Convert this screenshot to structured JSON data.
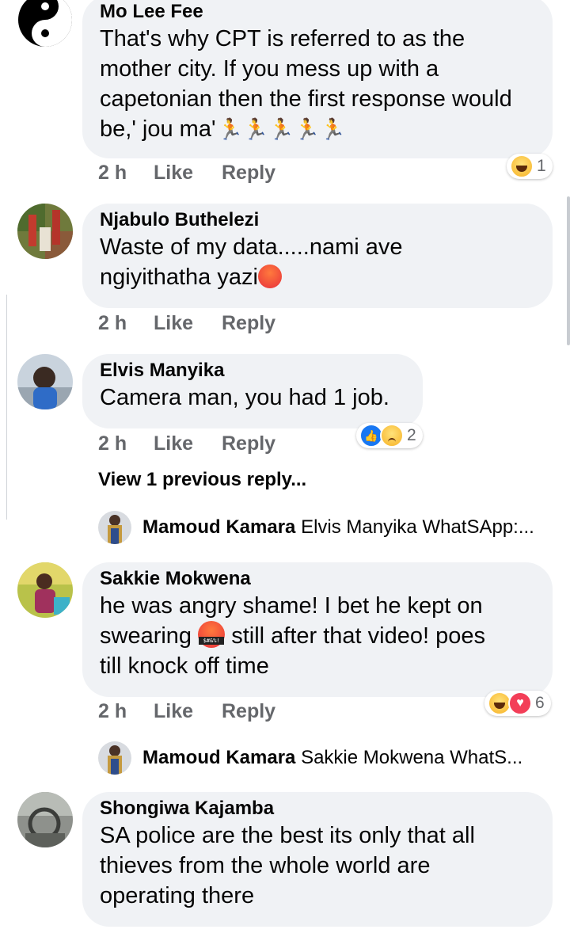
{
  "comments": [
    {
      "author": "Mo Lee Fee",
      "text": "That's why CPT is referred to as the mother city. If you mess up with a capetonian then the first response would be,' jou ma'",
      "emoji_tail": "🏃🏃🏃🏃🏃",
      "time": "2 h",
      "like": "Like",
      "reply": "Reply",
      "reactions": [
        "haha"
      ],
      "reaction_count": "1"
    },
    {
      "author": "Njabulo Buthelezi",
      "text_line1": "Waste of my data.....nami ave",
      "text_line2": "ngiyithatha yazi",
      "time": "2 h",
      "like": "Like",
      "reply": "Reply"
    },
    {
      "author": "Elvis Manyika",
      "text": "Camera man, you had 1 job.",
      "time": "2 h",
      "like": "Like",
      "reply": "Reply",
      "reactions": [
        "like",
        "sad"
      ],
      "reaction_count": "2",
      "view_more": "View 1 previous reply...",
      "reply_preview": {
        "author": "Mamoud Kamara",
        "text": "Elvis Manyika WhatSApp:..."
      }
    },
    {
      "author": "Sakkie Mokwena",
      "text_line1": "he was angry shame! I bet he kept on",
      "text_line2a": "swearing",
      "text_line2b": "still after that video! poes",
      "text_line3": "till knock off time",
      "time": "2 h",
      "like": "Like",
      "reply": "Reply",
      "reactions": [
        "haha",
        "love"
      ],
      "reaction_count": "6",
      "reply_preview": {
        "author": "Mamoud Kamara",
        "text": "Sakkie Mokwena WhatS..."
      }
    },
    {
      "author": "Shongiwa Kajamba",
      "text_line1": "SA police are the best its only that all",
      "text_line2": "thieves from the whole world are",
      "text_line3": "operating there"
    }
  ],
  "colors": {
    "bubble": "#f0f2f5",
    "meta": "#65676b",
    "like_blue": "#1877f2",
    "love_red": "#f33e58"
  }
}
